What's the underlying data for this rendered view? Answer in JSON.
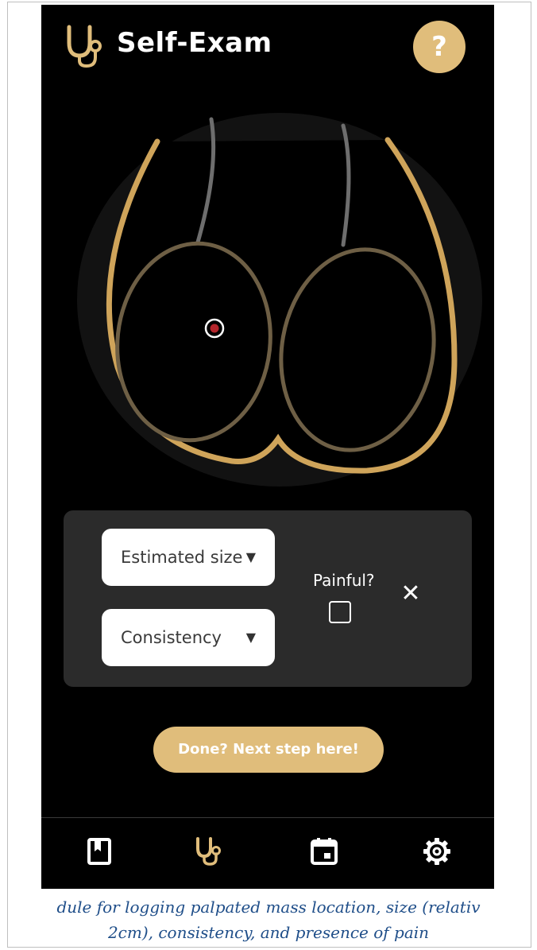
{
  "app": {
    "title": "Self-Exam",
    "help_label": "?",
    "accent_color": "#e0bd7b",
    "background_color": "#000000"
  },
  "lump_entry": {
    "size_select": {
      "selected": "Estimated size",
      "caret": "▼"
    },
    "consistency_select": {
      "selected": "Consistency",
      "caret": "▼"
    },
    "painful": {
      "label": "Painful?",
      "checked": false
    },
    "remove_label": "✕"
  },
  "next_button": {
    "label": "Done? Next step here!"
  },
  "bottom_nav": {
    "items": [
      {
        "icon": "journal-icon",
        "active": false
      },
      {
        "icon": "stethoscope-icon",
        "active": true
      },
      {
        "icon": "calendar-icon",
        "active": false
      },
      {
        "icon": "settings-gear-icon",
        "active": false
      }
    ]
  },
  "caption": {
    "line1": "dule for logging palpated mass location, size (relativ",
    "line2": "2cm), consistency, and presence of pain"
  }
}
